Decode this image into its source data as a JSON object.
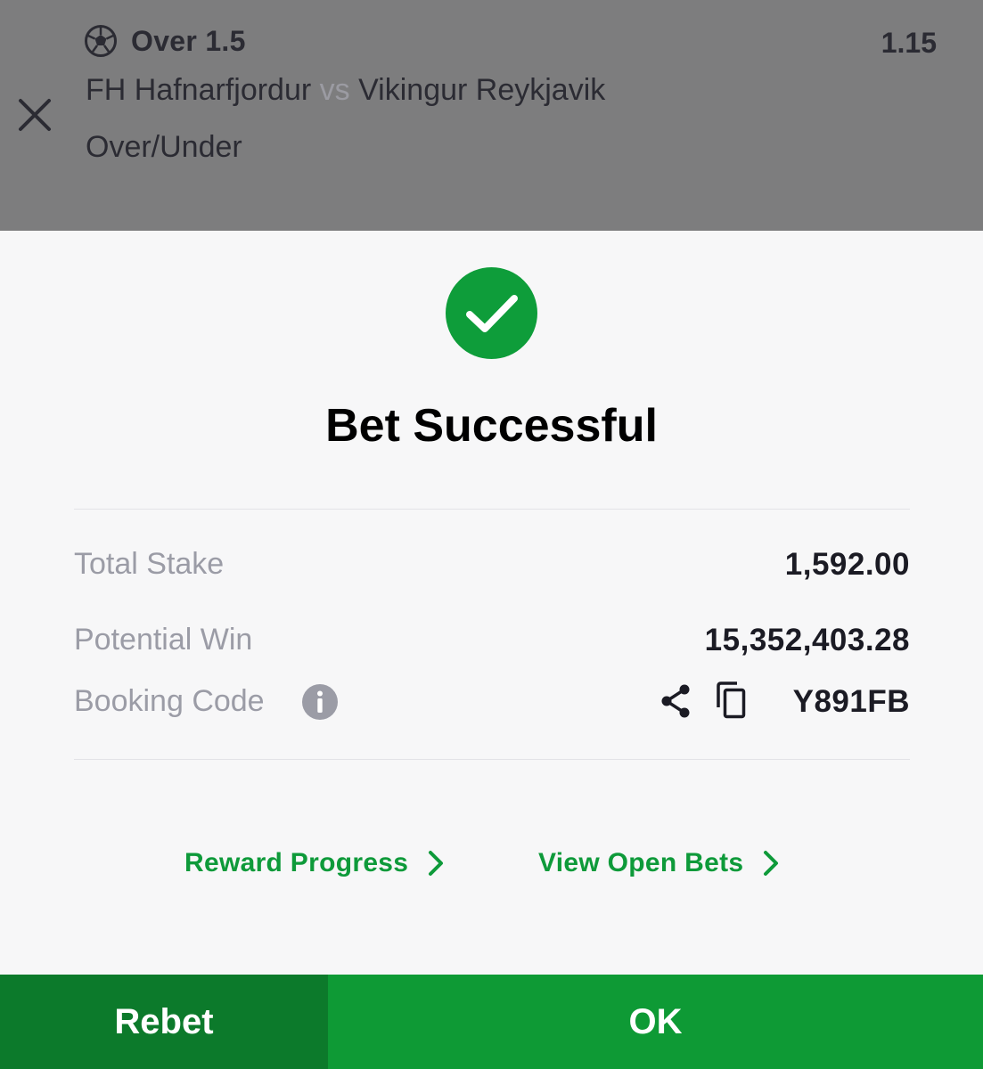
{
  "bet_slip": {
    "selection": "Over 1.5",
    "odds": "1.15",
    "home_team": "FH Hafnarfjordur",
    "vs": "vs",
    "away_team": "Vikingur Reykjavik",
    "market": "Over/Under"
  },
  "result": {
    "title": "Bet Successful",
    "total_stake_label": "Total Stake",
    "total_stake": "1,592.00",
    "potential_win_label": "Potential Win",
    "potential_win": "15,352,403.28",
    "booking_code_label": "Booking Code",
    "booking_code": "Y891FB"
  },
  "links": {
    "reward_progress": "Reward Progress",
    "view_open_bets": "View Open Bets"
  },
  "buttons": {
    "rebet": "Rebet",
    "ok": "OK"
  },
  "icons": {
    "close": "close-icon",
    "sport": "soccer-ball-icon",
    "success": "check-circle-icon",
    "info": "info-icon",
    "share": "share-icon",
    "copy": "copy-icon",
    "chevron": "chevron-right-icon"
  },
  "colors": {
    "brand_green": "#0e9a35",
    "dark_green": "#0c7a2b",
    "overlay_gray": "#7d7d7e",
    "label_gray": "#9b9ca6"
  }
}
